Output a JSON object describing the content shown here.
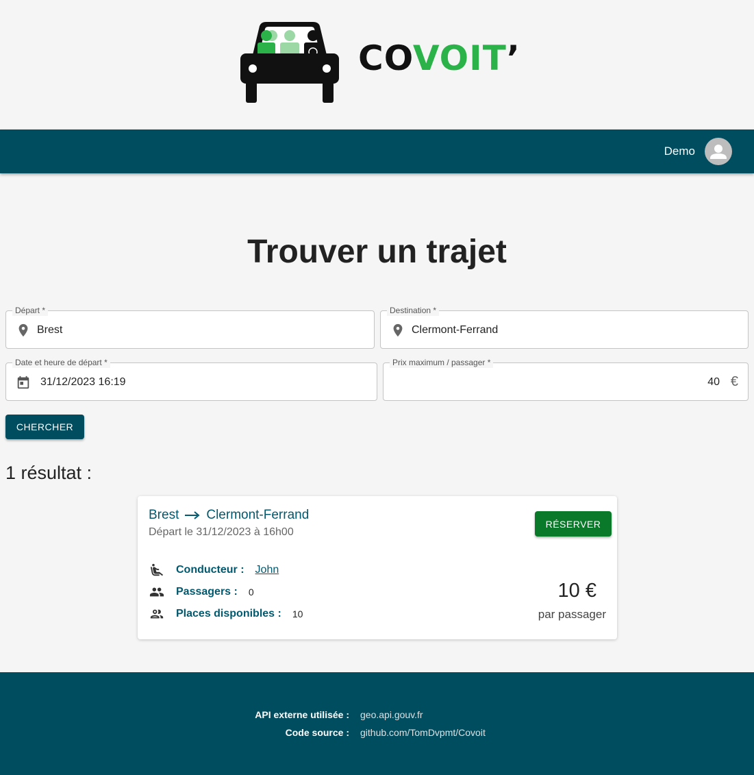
{
  "logo": {
    "text_dark": "CO",
    "text_green": "VOIT",
    "text_apos": "’"
  },
  "navbar": {
    "username": "Demo",
    "avatar_icon": "person-icon",
    "color": "#004d5f"
  },
  "search": {
    "title": "Trouver un trajet",
    "depart": {
      "label": "Départ *",
      "value": "Brest",
      "icon": "location-pin-icon"
    },
    "destination": {
      "label": "Destination *",
      "value": "Clermont-Ferrand",
      "icon": "location-pin-icon"
    },
    "date": {
      "label": "Date et heure de départ *",
      "value": "31/12/2023 16:19",
      "icon": "calendar-icon"
    },
    "prix": {
      "label": "Prix maximum / passager *",
      "value": "40",
      "suffix": "€"
    },
    "button_label": "CHERCHER"
  },
  "results": {
    "count_text": "1 résultat :",
    "items": [
      {
        "from": "Brest",
        "to": "Clermont-Ferrand",
        "departure": "Départ le 31/12/2023 à 16h00",
        "reserve_label": "RÉSERVER",
        "driver_label": "Conducteur :",
        "driver_name": "John",
        "passengers_label": "Passagers :",
        "passengers_value": "0",
        "places_label": "Places disponibles :",
        "places_value": "10",
        "price": "10 €",
        "price_unit": "par passager"
      }
    ]
  },
  "footer": {
    "api_label": "API externe utilisée :",
    "api_value": "geo.api.gouv.fr",
    "source_label": "Code source :",
    "source_value": "github.com/TomDvpmt/Covoit"
  },
  "colors": {
    "primary": "#004d5f",
    "green": "#2bb34a",
    "reserve": "#0a7a2a"
  }
}
